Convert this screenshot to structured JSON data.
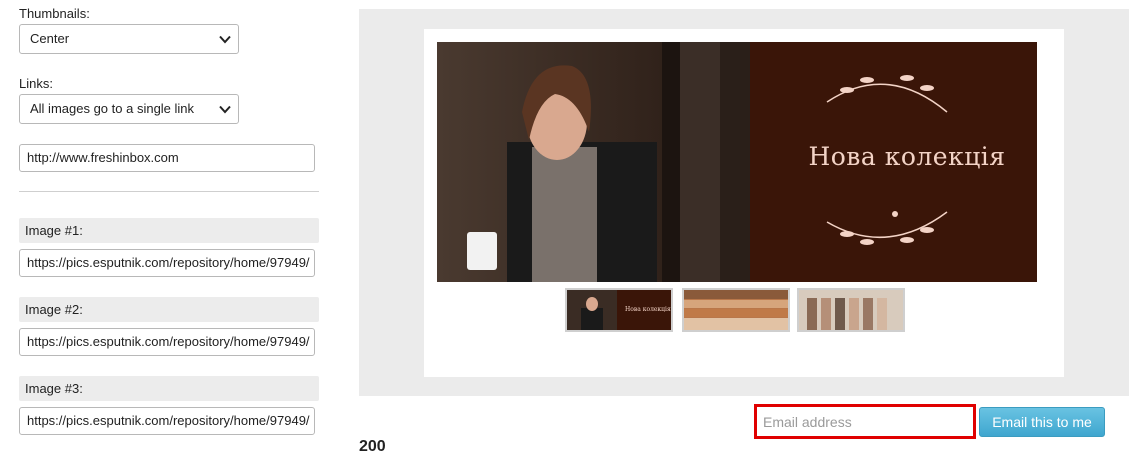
{
  "settings": {
    "thumbnails": {
      "label": "Thumbnails:",
      "value": "Center"
    },
    "links": {
      "label": "Links:",
      "value": "All images go to a single link"
    },
    "link_url": "http://www.freshinbox.com",
    "images": [
      {
        "label": "Image #1:",
        "url": "https://pics.esputnik.com/repository/home/97949/"
      },
      {
        "label": "Image #2:",
        "url": "https://pics.esputnik.com/repository/home/97949/"
      },
      {
        "label": "Image #3:",
        "url": "https://pics.esputnik.com/repository/home/97949/"
      }
    ]
  },
  "preview": {
    "banner_title": "Нова колекція",
    "thumbnail_caption": "Нова колекція"
  },
  "email": {
    "placeholder": "Email address",
    "button_label": "Email this to me"
  },
  "cut_text": "200",
  "colors": {
    "highlight_border": "#e00000",
    "button": "#4aaed4",
    "banner_bg": "#3a1508",
    "banner_text": "#f3d3c6"
  }
}
